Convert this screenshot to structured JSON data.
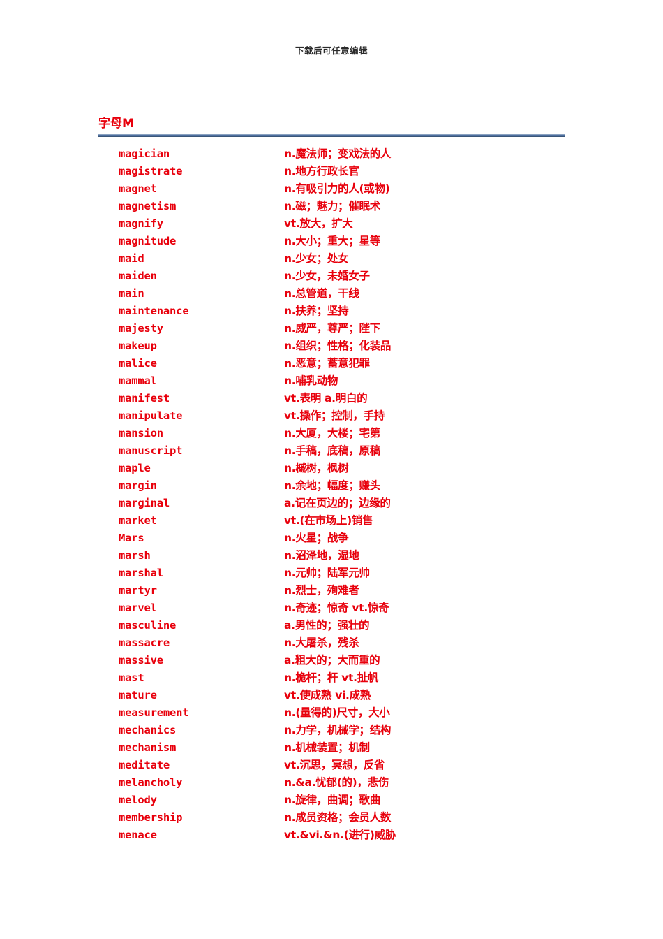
{
  "page": {
    "running_head": "下载后可任意编辑",
    "title": "字母M",
    "accent_color": "#e8000c",
    "rule_color": "#4f6f9f"
  },
  "vocabulary": [
    {
      "word": "magician",
      "definition": "n.魔法师；变戏法的人"
    },
    {
      "word": "magistrate",
      "definition": "n.地方行政长官"
    },
    {
      "word": "magnet",
      "definition": "n.有吸引力的人(或物)"
    },
    {
      "word": "magnetism",
      "definition": "n.磁；魅力；催眠术"
    },
    {
      "word": "magnify",
      "definition": "vt.放大，扩大"
    },
    {
      "word": "magnitude",
      "definition": "n.大小；重大；星等"
    },
    {
      "word": "maid",
      "definition": "n.少女；处女"
    },
    {
      "word": "maiden",
      "definition": "n.少女，未婚女子"
    },
    {
      "word": "main",
      "definition": "n.总管道，干线"
    },
    {
      "word": "maintenance",
      "definition": "n.扶养；坚持"
    },
    {
      "word": "majesty",
      "definition": "n.威严，尊严；陛下"
    },
    {
      "word": "makeup",
      "definition": "n.组织；性格；化装品"
    },
    {
      "word": "malice",
      "definition": "n.恶意；蓄意犯罪"
    },
    {
      "word": "mammal",
      "definition": "n.哺乳动物"
    },
    {
      "word": "manifest",
      "definition": "vt.表明 a.明白的"
    },
    {
      "word": "manipulate",
      "definition": "vt.操作；控制，手持"
    },
    {
      "word": "mansion",
      "definition": "n.大厦，大楼；宅第"
    },
    {
      "word": "manuscript",
      "definition": "n.手稿，底稿，原稿"
    },
    {
      "word": "maple",
      "definition": "n.槭树，枫树"
    },
    {
      "word": "margin",
      "definition": "n.余地；幅度；赚头"
    },
    {
      "word": "marginal",
      "definition": "a.记在页边的；边缘的"
    },
    {
      "word": "market",
      "definition": "vt.(在市场上)销售"
    },
    {
      "word": "Mars",
      "definition": "n.火星；战争"
    },
    {
      "word": "marsh",
      "definition": "n.沼泽地，湿地"
    },
    {
      "word": "marshal",
      "definition": "n.元帅；陆军元帅"
    },
    {
      "word": "martyr",
      "definition": "n.烈士，殉难者"
    },
    {
      "word": "marvel",
      "definition": "n.奇迹；惊奇 vt.惊奇"
    },
    {
      "word": "masculine",
      "definition": "a.男性的；强壮的"
    },
    {
      "word": "massacre",
      "definition": "n.大屠杀，残杀"
    },
    {
      "word": "massive",
      "definition": "a.粗大的；大而重的"
    },
    {
      "word": "mast",
      "definition": "n.桅杆；杆 vt.扯帆"
    },
    {
      "word": "mature",
      "definition": "vt.使成熟 vi.成熟"
    },
    {
      "word": "measurement",
      "definition": "n.(量得的)尺寸，大小"
    },
    {
      "word": "mechanics",
      "definition": "n.力学，机械学；结构"
    },
    {
      "word": "mechanism",
      "definition": "n.机械装置；机制"
    },
    {
      "word": "meditate",
      "definition": "vt.沉思，冥想，反省"
    },
    {
      "word": "melancholy",
      "definition": "n.&a.忧郁(的)，悲伤"
    },
    {
      "word": "melody",
      "definition": "n.旋律，曲调；歌曲"
    },
    {
      "word": "membership",
      "definition": "n.成员资格；会员人数"
    },
    {
      "word": "menace",
      "definition": "vt.&vi.&n.(进行)威胁"
    }
  ]
}
